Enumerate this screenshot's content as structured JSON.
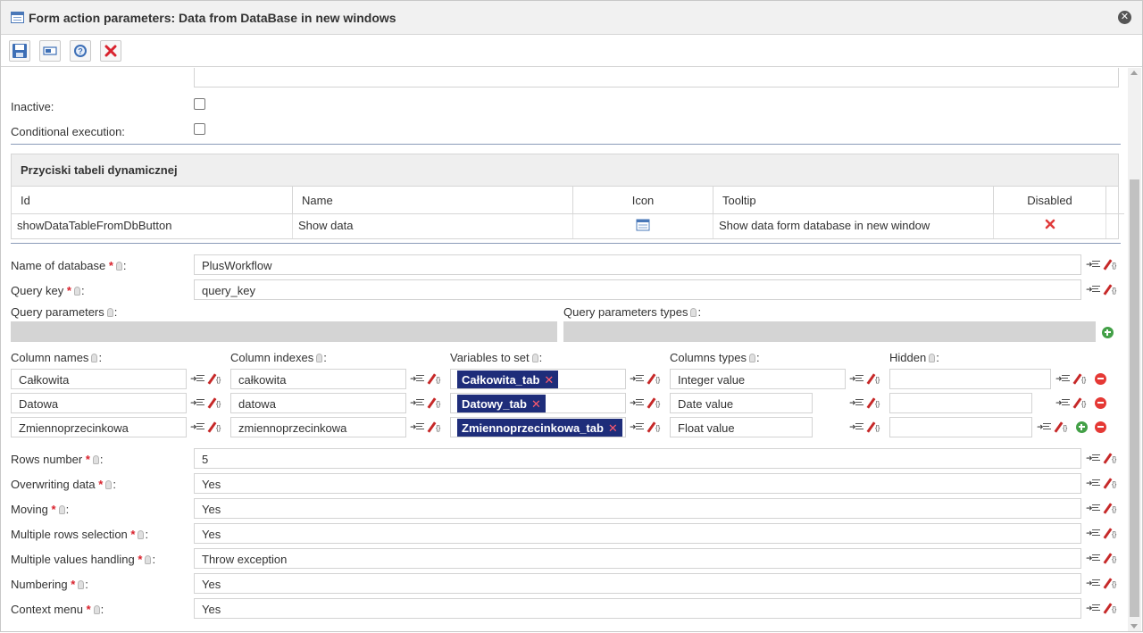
{
  "window": {
    "title": "Form action parameters: Data from DataBase in new windows",
    "title_icon": "table-icon",
    "close_icon": "close-icon"
  },
  "toolbar": {
    "buttons": [
      {
        "name": "save-button",
        "icon": "floppy-disk-icon"
      },
      {
        "name": "preview-button",
        "icon": "window-icon"
      },
      {
        "name": "help-button",
        "icon": "help-icon"
      },
      {
        "name": "cancel-button",
        "icon": "red-x-icon"
      }
    ]
  },
  "flags": {
    "inactive_label": "Inactive:",
    "conditional_label": "Conditional execution:"
  },
  "buttons_table": {
    "title": "Przyciski tabeli dynamicznej",
    "columns": [
      "Id",
      "Name",
      "Icon",
      "Tooltip",
      "Disabled"
    ],
    "row": {
      "id": "showDataTableFromDbButton",
      "name": "Show data",
      "icon": "table-icon",
      "tooltip": "Show data form database in new window",
      "disabled": "red-x-icon"
    }
  },
  "params": {
    "database_label": "Name of database",
    "database_value": "PlusWorkflow",
    "query_key_label": "Query key",
    "query_key_value": "query_key",
    "query_params_label": "Query parameters",
    "query_param_types_label": "Query parameters types"
  },
  "columns_section": {
    "headers": [
      "Column names",
      "Column indexes",
      "Variables to set",
      "Columns types",
      "Hidden"
    ],
    "rows": [
      {
        "name": "Całkowita",
        "index": "całkowita",
        "variable": "Całkowita_tab",
        "type": "Integer value",
        "hidden": ""
      },
      {
        "name": "Datowa",
        "index": "datowa",
        "variable": "Datowy_tab",
        "type": "Date value",
        "hidden": ""
      },
      {
        "name": "Zmiennoprzecinkowa",
        "index": "zmiennoprzecinkowa",
        "variable": "Zmiennoprzecinkowa_tab",
        "type": "Float value",
        "hidden": ""
      }
    ]
  },
  "settings": [
    {
      "label": "Rows number",
      "value": "5"
    },
    {
      "label": "Overwriting data",
      "value": "Yes"
    },
    {
      "label": "Moving",
      "value": "Yes"
    },
    {
      "label": "Multiple rows selection",
      "value": "Yes"
    },
    {
      "label": "Multiple values handling",
      "value": "Throw exception"
    },
    {
      "label": "Numbering",
      "value": "Yes"
    },
    {
      "label": "Context menu",
      "value": "Yes"
    }
  ],
  "colors": {
    "tag_bg": "#1e2d7a",
    "required": "#d9232e",
    "separator": "#8a9bb8"
  }
}
